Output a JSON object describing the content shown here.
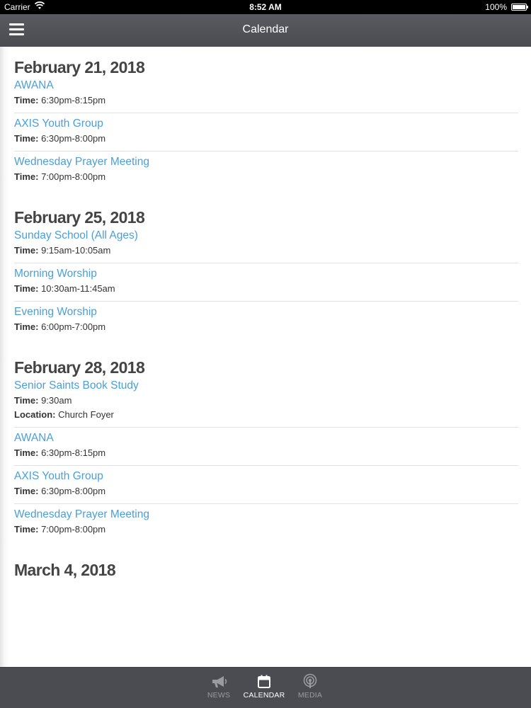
{
  "status_bar": {
    "carrier": "Carrier",
    "time": "8:52 AM",
    "battery": "100%"
  },
  "nav": {
    "title": "Calendar"
  },
  "days": [
    {
      "date": "February 21, 2018",
      "events": [
        {
          "title": "AWANA",
          "time_label": "Time:",
          "time": "6:30pm-8:15pm"
        },
        {
          "title": "AXIS Youth Group",
          "time_label": "Time:",
          "time": "6:30pm-8:00pm"
        },
        {
          "title": "Wednesday Prayer Meeting",
          "time_label": "Time:",
          "time": "7:00pm-8:00pm"
        }
      ]
    },
    {
      "date": "February 25, 2018",
      "events": [
        {
          "title": "Sunday School (All Ages)",
          "time_label": "Time:",
          "time": "9:15am-10:05am"
        },
        {
          "title": "Morning Worship",
          "time_label": "Time:",
          "time": "10:30am-11:45am"
        },
        {
          "title": "Evening Worship",
          "time_label": "Time:",
          "time": "6:00pm-7:00pm"
        }
      ]
    },
    {
      "date": "February 28, 2018",
      "events": [
        {
          "title": "Senior Saints Book Study",
          "time_label": "Time:",
          "time": "9:30am",
          "location_label": "Location:",
          "location": "Church Foyer"
        },
        {
          "title": "AWANA",
          "time_label": "Time:",
          "time": "6:30pm-8:15pm"
        },
        {
          "title": "AXIS Youth Group",
          "time_label": "Time:",
          "time": "6:30pm-8:00pm"
        },
        {
          "title": "Wednesday Prayer Meeting",
          "time_label": "Time:",
          "time": "7:00pm-8:00pm"
        }
      ]
    },
    {
      "date": "March 4, 2018",
      "events": []
    }
  ],
  "tabs": [
    {
      "label": "NEWS",
      "icon": "megaphone-icon",
      "active": false
    },
    {
      "label": "CALENDAR",
      "icon": "calendar-icon",
      "active": true
    },
    {
      "label": "MEDIA",
      "icon": "podcast-icon",
      "active": false
    }
  ],
  "colors": {
    "link": "#4a9fd8",
    "nav_bg": "#54555a",
    "tab_bg": "#4b4c51",
    "header_text": "#444444"
  }
}
